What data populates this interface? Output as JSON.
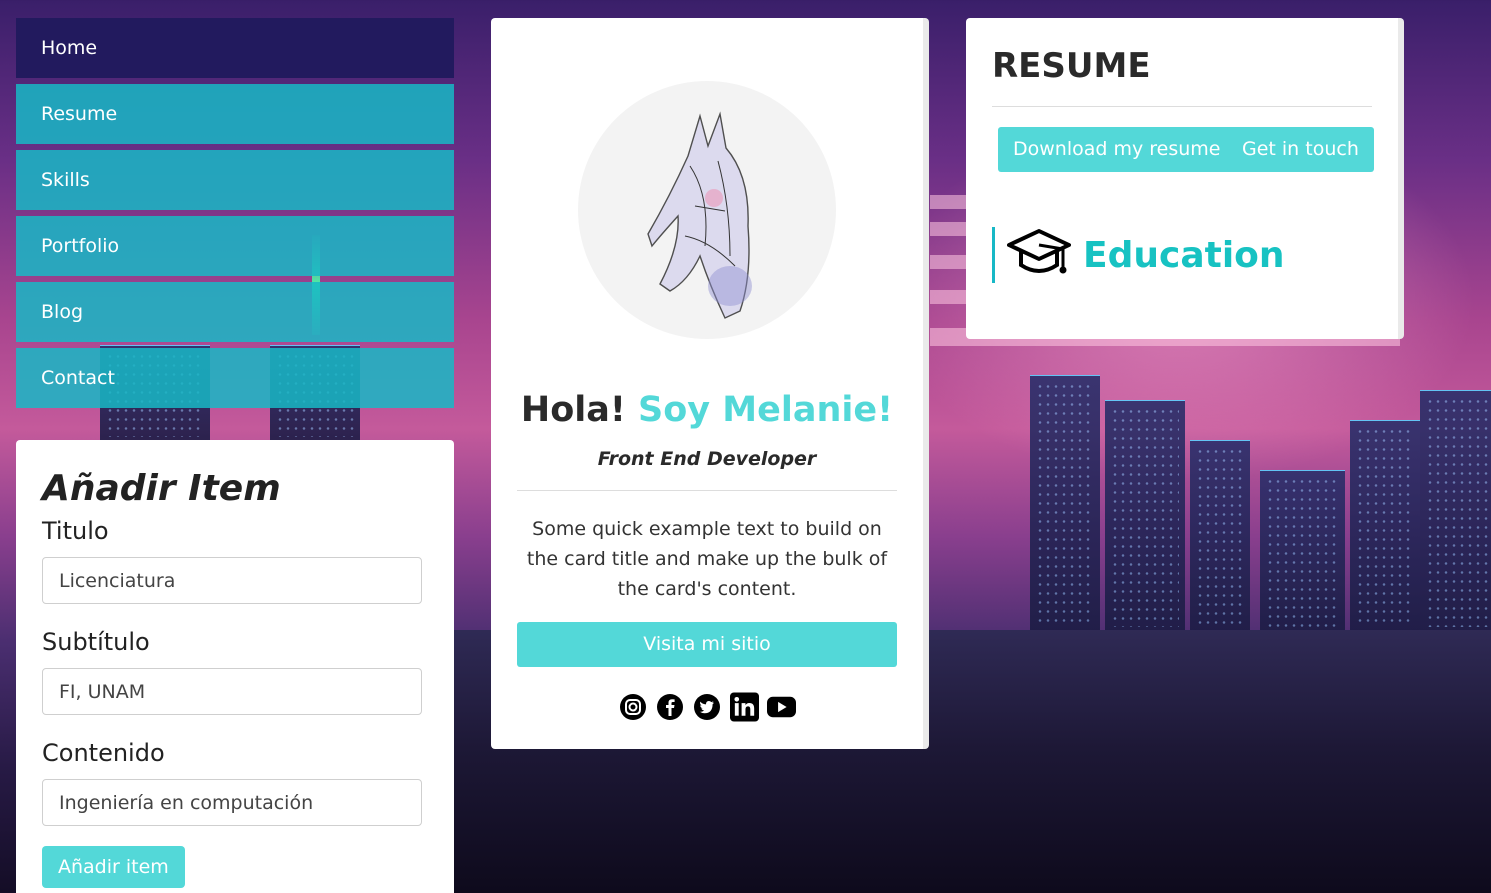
{
  "nav": {
    "items": [
      {
        "label": "Home",
        "active": true
      },
      {
        "label": "Resume",
        "active": false
      },
      {
        "label": "Skills",
        "active": false
      },
      {
        "label": "Portfolio",
        "active": false
      },
      {
        "label": "Blog",
        "active": false
      },
      {
        "label": "Contact",
        "active": false
      }
    ]
  },
  "add_item": {
    "title": "Añadir Item",
    "fields": [
      {
        "label": "Titulo",
        "value": "Licenciatura"
      },
      {
        "label": "Subtítulo",
        "value": "FI, UNAM"
      },
      {
        "label": "Contenido",
        "value": "Ingeniería en computación"
      }
    ],
    "button_label": "Añadir item"
  },
  "profile": {
    "greeting": "Hola!",
    "name": "Soy Melanie!",
    "role": "Front End Developer",
    "description": "Some quick example text to build on the card title and make up the bulk of the card's content.",
    "button_label": "Visita mi sitio",
    "socials": [
      "instagram-icon",
      "facebook-icon",
      "twitter-icon",
      "linkedin-icon",
      "youtube-icon"
    ]
  },
  "resume": {
    "title": "RESUME",
    "download_label": "Download my resume",
    "contact_label": "Get in touch",
    "section_title": "Education",
    "section_icon": "graduation-cap-icon"
  },
  "colors": {
    "accent": "#53d8d8",
    "nav_bg": "#17b8c6",
    "nav_active": "#221a5e",
    "education_title": "#17c2c2"
  }
}
